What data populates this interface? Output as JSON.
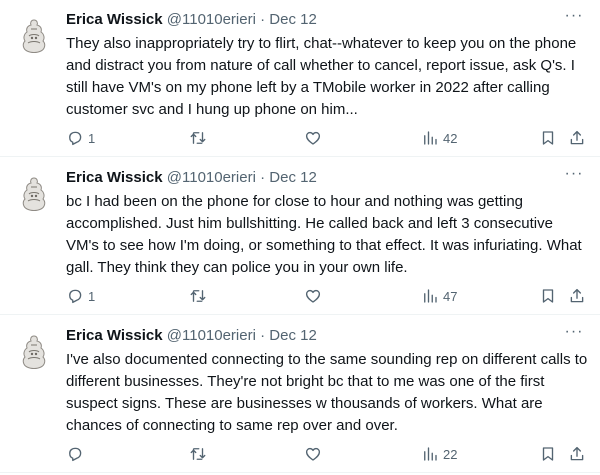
{
  "tweets": [
    {
      "author": {
        "name": "Erica Wissick",
        "handle": "@11010erieri"
      },
      "separator": "·",
      "date": "Dec 12",
      "more": "···",
      "text": "They also inappropriately try to flirt, chat--whatever to keep you on the phone and distract you from nature of call whether to cancel, report issue, ask Q's. I still have VM's on my phone left by a TMobile worker in 2022 after calling customer svc and I hung up phone on him...",
      "stats": {
        "replies": "1",
        "retweets": "",
        "likes": "",
        "views": "42"
      }
    },
    {
      "author": {
        "name": "Erica Wissick",
        "handle": "@11010erieri"
      },
      "separator": "·",
      "date": "Dec 12",
      "more": "···",
      "text": "bc I had been on the phone for close to hour and nothing was getting accomplished. Just him bullshitting. He called back and left 3 consecutive VM's to see how I'm doing, or something to that effect. It was infuriating. What gall. They think they can police you in your own life.",
      "stats": {
        "replies": "1",
        "retweets": "",
        "likes": "",
        "views": "47"
      }
    },
    {
      "author": {
        "name": "Erica Wissick",
        "handle": "@11010erieri"
      },
      "separator": "·",
      "date": "Dec 12",
      "more": "···",
      "text": "I've also documented connecting to the same sounding rep on different calls to different businesses. They're not bright bc that to me was one of the first suspect signs. These are businesses w thousands of workers. What are chances of connecting to same rep over and over.",
      "stats": {
        "replies": "",
        "retweets": "",
        "likes": "",
        "views": "22"
      }
    }
  ],
  "icons": {
    "reply": "reply-icon",
    "retweet": "retweet-icon",
    "like": "heart-icon",
    "views": "views-icon",
    "bookmark": "bookmark-icon",
    "share": "share-icon"
  },
  "colors": {
    "text": "#0f1419",
    "secondary": "#536471",
    "divider": "#eff3f4"
  }
}
